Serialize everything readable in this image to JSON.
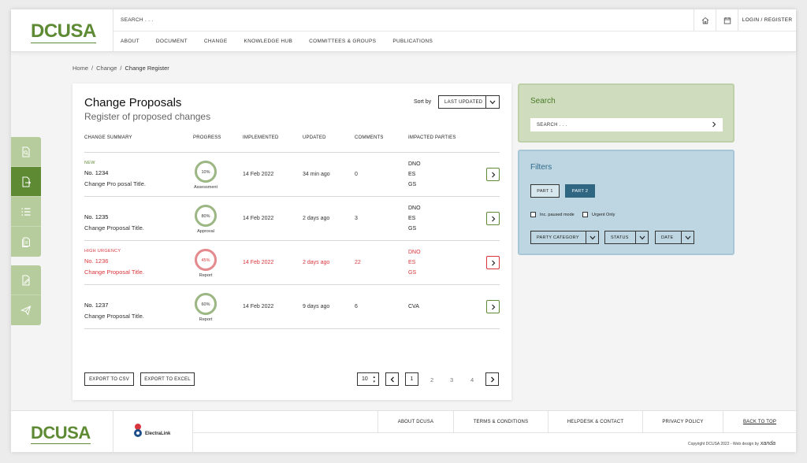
{
  "brand": {
    "logo_text": "DCUSA",
    "accent": "#5e8a34",
    "urgent": "#d8363c"
  },
  "header": {
    "search_placeholder": "SEARCH . . .",
    "nav": [
      "ABOUT",
      "DOCUMENT",
      "CHANGE",
      "KNOWLEDGE HUB",
      "COMMITTEES & GROUPS",
      "PUBLICATIONS"
    ],
    "icons": [
      "home-icon",
      "calendar-icon"
    ],
    "login": "LOGIN / REGISTER"
  },
  "breadcrumb": {
    "home": "Home",
    "change": "Change",
    "current": "Change Register",
    "separator": "/"
  },
  "sidebar": {
    "group1": [
      "document-search-icon",
      "document-export-icon",
      "list-icon",
      "document-stack-icon"
    ],
    "group2": [
      "document-edit-icon",
      "send-icon"
    ]
  },
  "main": {
    "title": "Change Proposals",
    "subtitle": "Register of proposed changes",
    "sort_label": "Sort by",
    "sort_value": "LAST UPDATED",
    "columns": [
      "CHANGE SUMMARY",
      "PROGRESS",
      "IMPLEMENTED",
      "UPDATED",
      "COMMENTS",
      "IMPACTED PARTIES"
    ],
    "rows": [
      {
        "tag": "NEW",
        "number": "No. 1234",
        "title": "Change Pro posal Title.",
        "progress_pct": "10%",
        "progress": 10,
        "stage": "Assessment",
        "implemented": "14 Feb 2022",
        "updated": "34 min ago",
        "comments": "0",
        "parties": [
          "DNO",
          "ES",
          "GS"
        ],
        "urgent": false
      },
      {
        "tag": "",
        "number": "No. 1235",
        "title": "Change Proposal Title.",
        "progress_pct": "80%",
        "progress": 80,
        "stage": "Approval",
        "implemented": "14 Feb 2022",
        "updated": "2 days ago",
        "comments": "3",
        "parties": [
          "DNO",
          "ES",
          "GS"
        ],
        "urgent": false
      },
      {
        "tag": "HIGH URGENCY",
        "number": "No. 1236",
        "title": "Change Proposal Title.",
        "progress_pct": "45%",
        "progress": 45,
        "stage": "Report",
        "implemented": "14 Feb 2022",
        "updated": "2 days ago",
        "comments": "22",
        "parties": [
          "DNO",
          "ES",
          "GS"
        ],
        "urgent": true
      },
      {
        "tag": "",
        "number": "No. 1237",
        "title": "Change Proposal Title.",
        "progress_pct": "60%",
        "progress": 60,
        "stage": "Report",
        "implemented": "14 Feb 2022",
        "updated": "9 days ago",
        "comments": "6",
        "parties": [
          "CVA"
        ],
        "urgent": false
      }
    ],
    "export_csv": "EXPORT TO CSV",
    "export_excel": "EXPORT TO EXCEL",
    "per_page": "10",
    "pages": [
      "1",
      "2",
      "3",
      "4"
    ],
    "current_page": "1"
  },
  "search_panel": {
    "title": "Search",
    "placeholder": "SEARCH . . ."
  },
  "filters": {
    "title": "Filters",
    "part1": "PART 1",
    "part2": "PART 2",
    "checkbox1": "Inc. paused mode",
    "checkbox2": "Urgent Only",
    "dropdowns": [
      "PARTY CATEGORY",
      "STATUS",
      "DATE"
    ]
  },
  "footer": {
    "logo_text": "DCUSA",
    "partner": "ElectraLink",
    "links": [
      "ABOUT DCUSA",
      "TERMS & CONDITIONS",
      "HELPDESK & CONTACT",
      "PRIVACY POLICY",
      "BACK TO TOP"
    ],
    "copyright": "Copyright DCUSA 2022 - Web design by",
    "designer": "xanda"
  }
}
